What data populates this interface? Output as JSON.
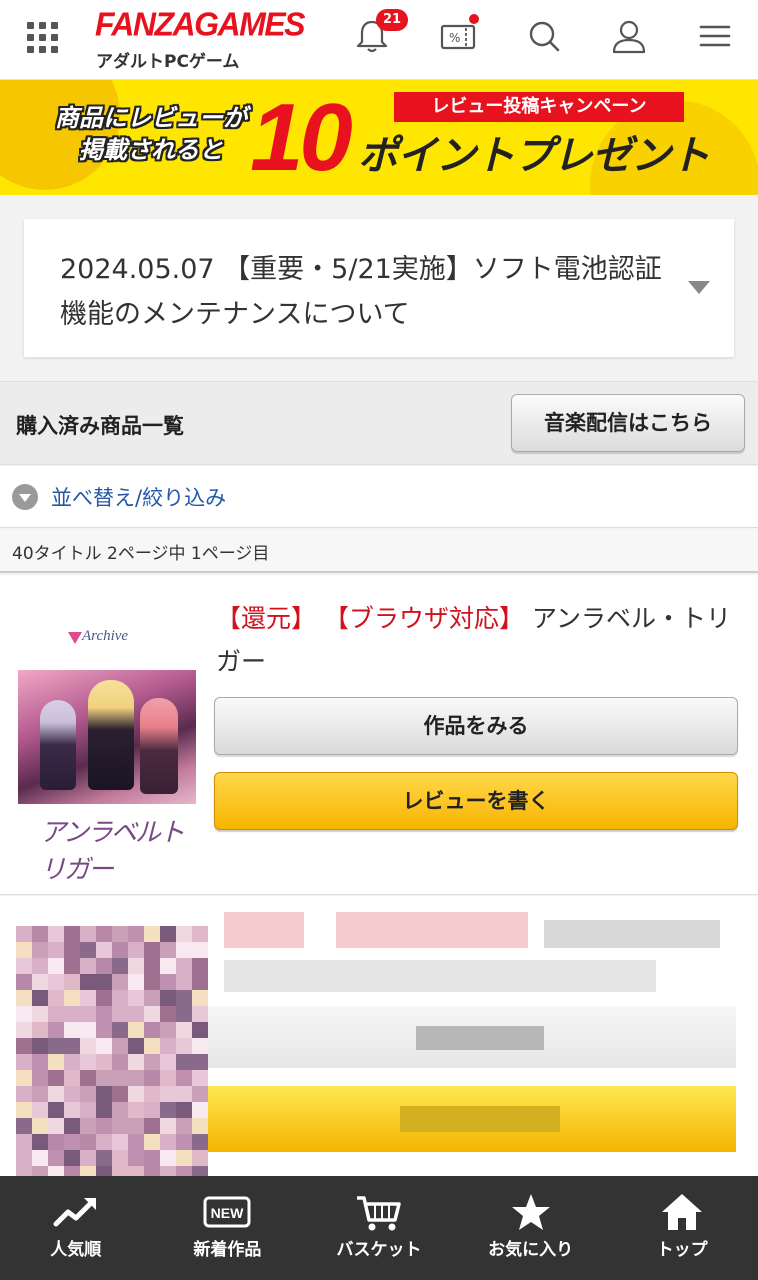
{
  "header": {
    "logo": "FANZAGAMES",
    "logo_sub": "アダルトPCゲーム",
    "notification_count": "21"
  },
  "banner": {
    "left_line1": "商品にレビューが",
    "left_line2": "掲載されると",
    "big_number": "10",
    "tag": "レビュー投稿キャンペーン",
    "main": "ポイントプレゼント"
  },
  "notice": {
    "text": "2024.05.07 【重要・5/21実施】ソフト電池認証機能のメンテナンスについて"
  },
  "purchased": {
    "title": "購入済み商品一覧",
    "music_button": "音楽配信はこちら"
  },
  "sort": {
    "label": "並べ替え/絞り込み"
  },
  "count": {
    "text": "40タイトル 2ページ中 1ページ目"
  },
  "product": {
    "tag1": "【還元】",
    "tag2": "【ブラウザ対応】",
    "name": "アンラベル・トリガー",
    "cover_brand": "Archive",
    "cover_logo": "アンラベルトリガー",
    "view_button": "作品をみる",
    "review_button": "レビューを書く"
  },
  "bottom_nav": [
    {
      "label": "人気順",
      "icon": "trending-icon"
    },
    {
      "label": "新着作品",
      "icon": "new-badge-icon",
      "icon_text": "NEW"
    },
    {
      "label": "バスケット",
      "icon": "cart-icon"
    },
    {
      "label": "お気に入り",
      "icon": "star-icon"
    },
    {
      "label": "トップ",
      "icon": "home-icon"
    }
  ],
  "colors": {
    "brand_red": "#e8121e",
    "banner_yellow": "#ffe600",
    "link_blue": "#2458a8",
    "review_button": "#f7b500",
    "nav_bg": "#333333"
  }
}
